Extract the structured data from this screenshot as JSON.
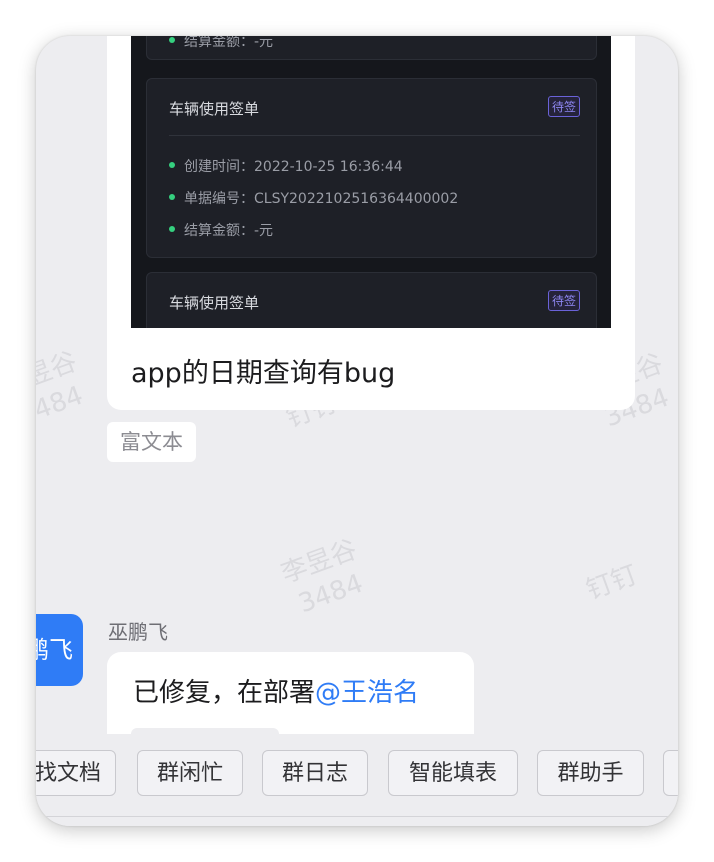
{
  "watermark": {
    "name": "李昱谷",
    "id": "3484",
    "app": "钉钉"
  },
  "first_message": {
    "screenshot": {
      "partial_row_label": "结算金额：",
      "partial_row_value": "-元",
      "cards": [
        {
          "title": "车辆使用签单",
          "badge": "待签",
          "rows": [
            {
              "label": "创建时间：",
              "value": "2022-10-25 16:36:44"
            },
            {
              "label": "单据编号：",
              "value": "CLSY2022102516364400002"
            },
            {
              "label": "结算金额：",
              "value": "-元"
            }
          ]
        },
        {
          "title": "车辆使用签单",
          "badge": "待签"
        }
      ]
    },
    "text": "app的日期查询有bug",
    "tag": "富文本"
  },
  "second_message": {
    "avatar_text": "鹏飞",
    "sender": "巫鹏飞",
    "text": "已修复，在部署",
    "mention": "@王浩名"
  },
  "toolbar": {
    "chips": [
      "找文档",
      "群闲忙",
      "群日志",
      "智能填表",
      "群助手",
      ""
    ]
  },
  "colors": {
    "accent": "#2f7cf6",
    "badge": "#8d86f0",
    "status_dot": "#35d07f"
  }
}
